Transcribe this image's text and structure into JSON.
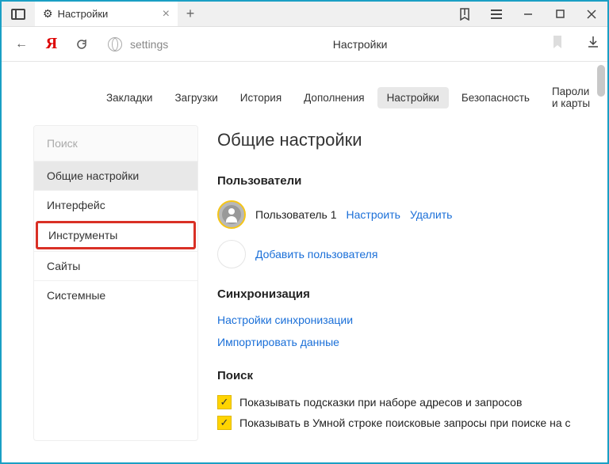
{
  "titlebar": {
    "tab_title": "Настройки",
    "close": "×",
    "plus": "+"
  },
  "toolbar": {
    "back": "←",
    "logo": "Я",
    "refresh": "↻",
    "url": "settings",
    "page_name": "Настройки"
  },
  "tabnav": {
    "items": [
      {
        "label": "Закладки"
      },
      {
        "label": "Загрузки"
      },
      {
        "label": "История"
      },
      {
        "label": "Дополнения"
      },
      {
        "label": "Настройки"
      },
      {
        "label": "Безопасность"
      },
      {
        "label": "Пароли и карты"
      }
    ]
  },
  "sidebar": {
    "search_placeholder": "Поиск",
    "items": [
      {
        "label": "Общие настройки"
      },
      {
        "label": "Интерфейс"
      },
      {
        "label": "Инструменты"
      },
      {
        "label": "Сайты"
      },
      {
        "label": "Системные"
      }
    ]
  },
  "content": {
    "heading": "Общие настройки",
    "users_heading": "Пользователи",
    "user1": {
      "name": "Пользователь 1",
      "configure": "Настроить",
      "delete": "Удалить"
    },
    "add_user": "Добавить пользователя",
    "sync_heading": "Синхронизация",
    "sync_settings": "Настройки синхронизации",
    "import_data": "Импортировать данные",
    "search_heading": "Поиск",
    "cb1": "Показывать подсказки при наборе адресов и запросов",
    "cb2": "Показывать в Умной строке поисковые запросы при поиске на с"
  }
}
